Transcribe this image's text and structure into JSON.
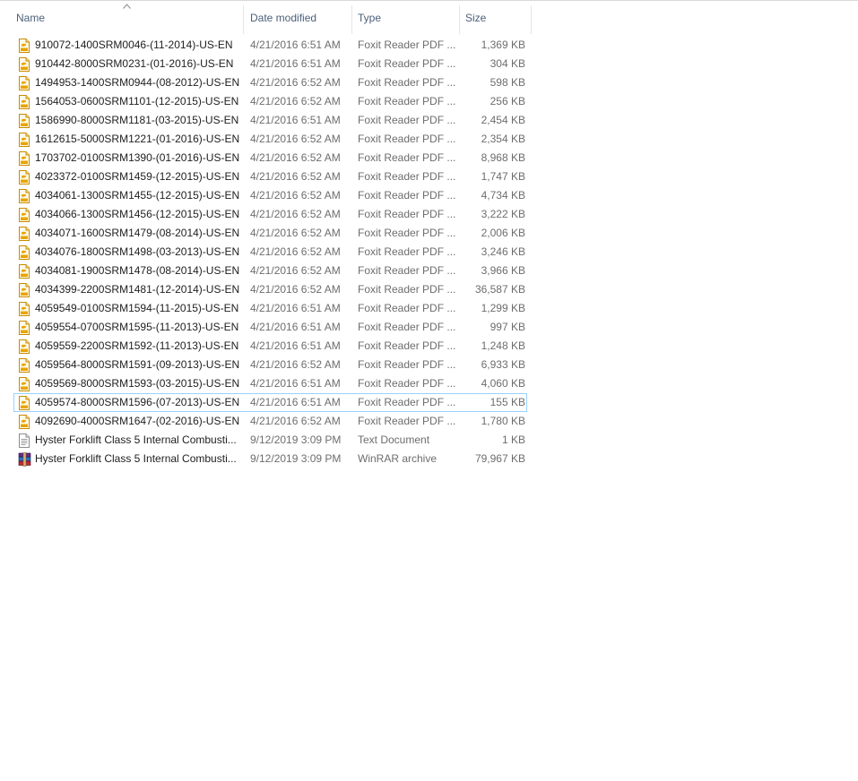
{
  "columns": {
    "name": "Name",
    "date": "Date modified",
    "type": "Type",
    "size": "Size"
  },
  "focused_row": 19,
  "icon_names": {
    "pdf": "foxit-pdf-icon",
    "txt": "text-document-icon",
    "rar": "winrar-archive-icon"
  },
  "files": [
    {
      "name": "910072-1400SRM0046-(11-2014)-US-EN",
      "date": "4/21/2016 6:51 AM",
      "type": "Foxit Reader PDF ...",
      "size": "1,369 KB",
      "icon": "pdf"
    },
    {
      "name": "910442-8000SRM0231-(01-2016)-US-EN",
      "date": "4/21/2016 6:51 AM",
      "type": "Foxit Reader PDF ...",
      "size": "304 KB",
      "icon": "pdf"
    },
    {
      "name": "1494953-1400SRM0944-(08-2012)-US-EN",
      "date": "4/21/2016 6:52 AM",
      "type": "Foxit Reader PDF ...",
      "size": "598 KB",
      "icon": "pdf"
    },
    {
      "name": "1564053-0600SRM1101-(12-2015)-US-EN",
      "date": "4/21/2016 6:52 AM",
      "type": "Foxit Reader PDF ...",
      "size": "256 KB",
      "icon": "pdf"
    },
    {
      "name": "1586990-8000SRM1181-(03-2015)-US-EN",
      "date": "4/21/2016 6:51 AM",
      "type": "Foxit Reader PDF ...",
      "size": "2,454 KB",
      "icon": "pdf"
    },
    {
      "name": "1612615-5000SRM1221-(01-2016)-US-EN",
      "date": "4/21/2016 6:52 AM",
      "type": "Foxit Reader PDF ...",
      "size": "2,354 KB",
      "icon": "pdf"
    },
    {
      "name": "1703702-0100SRM1390-(01-2016)-US-EN",
      "date": "4/21/2016 6:52 AM",
      "type": "Foxit Reader PDF ...",
      "size": "8,968 KB",
      "icon": "pdf"
    },
    {
      "name": "4023372-0100SRM1459-(12-2015)-US-EN",
      "date": "4/21/2016 6:52 AM",
      "type": "Foxit Reader PDF ...",
      "size": "1,747 KB",
      "icon": "pdf"
    },
    {
      "name": "4034061-1300SRM1455-(12-2015)-US-EN",
      "date": "4/21/2016 6:52 AM",
      "type": "Foxit Reader PDF ...",
      "size": "4,734 KB",
      "icon": "pdf"
    },
    {
      "name": "4034066-1300SRM1456-(12-2015)-US-EN",
      "date": "4/21/2016 6:52 AM",
      "type": "Foxit Reader PDF ...",
      "size": "3,222 KB",
      "icon": "pdf"
    },
    {
      "name": "4034071-1600SRM1479-(08-2014)-US-EN",
      "date": "4/21/2016 6:52 AM",
      "type": "Foxit Reader PDF ...",
      "size": "2,006 KB",
      "icon": "pdf"
    },
    {
      "name": "4034076-1800SRM1498-(03-2013)-US-EN",
      "date": "4/21/2016 6:52 AM",
      "type": "Foxit Reader PDF ...",
      "size": "3,246 KB",
      "icon": "pdf"
    },
    {
      "name": "4034081-1900SRM1478-(08-2014)-US-EN",
      "date": "4/21/2016 6:52 AM",
      "type": "Foxit Reader PDF ...",
      "size": "3,966 KB",
      "icon": "pdf"
    },
    {
      "name": "4034399-2200SRM1481-(12-2014)-US-EN",
      "date": "4/21/2016 6:52 AM",
      "type": "Foxit Reader PDF ...",
      "size": "36,587 KB",
      "icon": "pdf"
    },
    {
      "name": "4059549-0100SRM1594-(11-2015)-US-EN",
      "date": "4/21/2016 6:51 AM",
      "type": "Foxit Reader PDF ...",
      "size": "1,299 KB",
      "icon": "pdf"
    },
    {
      "name": "4059554-0700SRM1595-(11-2013)-US-EN",
      "date": "4/21/2016 6:51 AM",
      "type": "Foxit Reader PDF ...",
      "size": "997 KB",
      "icon": "pdf"
    },
    {
      "name": "4059559-2200SRM1592-(11-2013)-US-EN",
      "date": "4/21/2016 6:51 AM",
      "type": "Foxit Reader PDF ...",
      "size": "1,248 KB",
      "icon": "pdf"
    },
    {
      "name": "4059564-8000SRM1591-(09-2013)-US-EN",
      "date": "4/21/2016 6:52 AM",
      "type": "Foxit Reader PDF ...",
      "size": "6,933 KB",
      "icon": "pdf"
    },
    {
      "name": "4059569-8000SRM1593-(03-2015)-US-EN",
      "date": "4/21/2016 6:51 AM",
      "type": "Foxit Reader PDF ...",
      "size": "4,060 KB",
      "icon": "pdf"
    },
    {
      "name": "4059574-8000SRM1596-(07-2013)-US-EN",
      "date": "4/21/2016 6:51 AM",
      "type": "Foxit Reader PDF ...",
      "size": "155 KB",
      "icon": "pdf"
    },
    {
      "name": "4092690-4000SRM1647-(02-2016)-US-EN",
      "date": "4/21/2016 6:52 AM",
      "type": "Foxit Reader PDF ...",
      "size": "1,780 KB",
      "icon": "pdf"
    },
    {
      "name": "Hyster Forklift Class 5 Internal Combusti...",
      "date": "9/12/2019 3:09 PM",
      "type": "Text Document",
      "size": "1 KB",
      "icon": "txt"
    },
    {
      "name": "Hyster Forklift Class 5 Internal Combusti...",
      "date": "9/12/2019 3:09 PM",
      "type": "WinRAR archive",
      "size": "79,967 KB",
      "icon": "rar"
    }
  ]
}
